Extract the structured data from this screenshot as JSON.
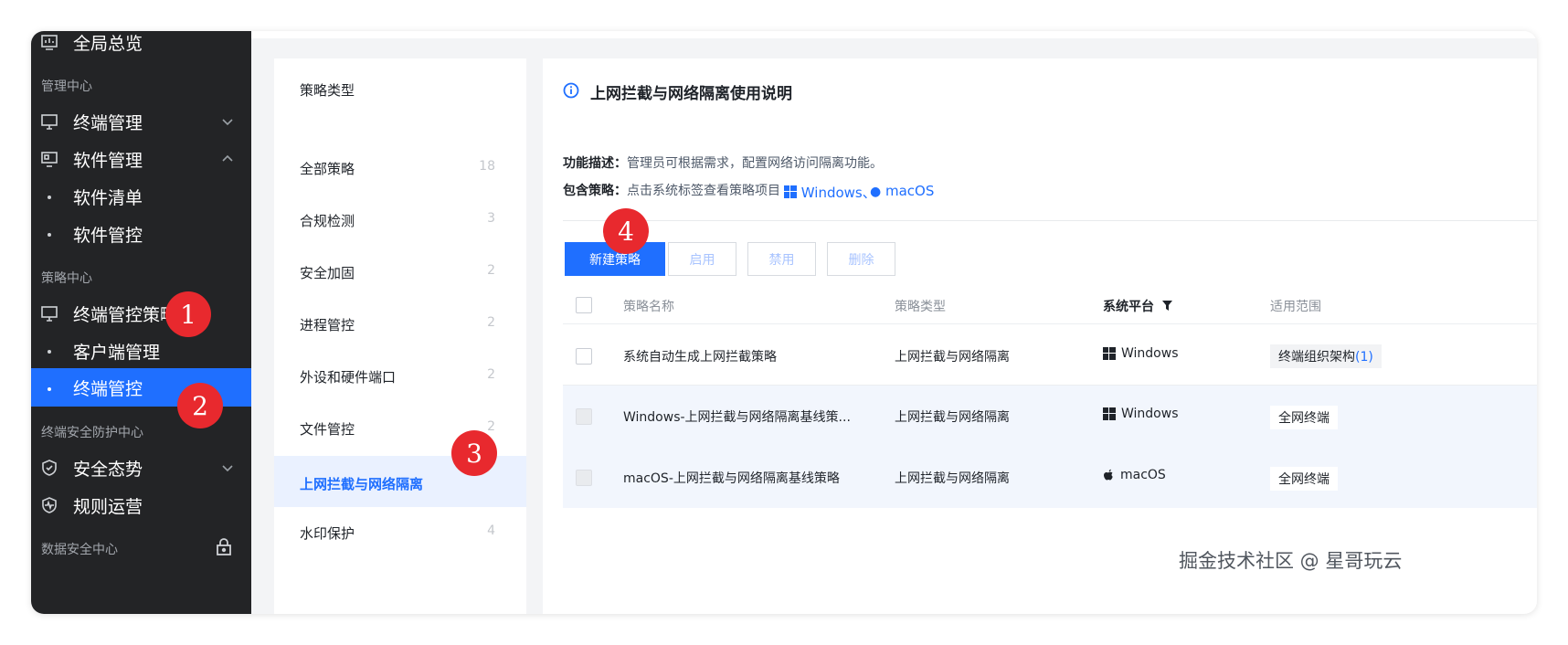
{
  "sidebar": {
    "overview": "全局总览",
    "section_manage": "管理中心",
    "terminal_manage": "终端管理",
    "software_manage": "软件管理",
    "software_list": "软件清单",
    "software_control": "软件管控",
    "section_policy": "策略中心",
    "terminal_policy": "终端管控策略",
    "client_manage": "客户端管理",
    "terminal_control": "终端管控",
    "section_security": "终端安全防护中心",
    "security_posture": "安全态势",
    "rule_ops": "规则运营",
    "section_data": "数据安全中心"
  },
  "categories": {
    "title": "策略类型",
    "items": [
      {
        "name": "全部策略",
        "count": "18"
      },
      {
        "name": "合规检测",
        "count": "3"
      },
      {
        "name": "安全加固",
        "count": "2"
      },
      {
        "name": "进程管控",
        "count": "2"
      },
      {
        "name": "外设和硬件端口",
        "count": "2"
      },
      {
        "name": "文件管控",
        "count": "2"
      },
      {
        "name": "上网拦截与网络隔离",
        "count": ""
      },
      {
        "name": "水印保护",
        "count": "4"
      }
    ]
  },
  "main": {
    "title": "上网拦截与网络隔离使用说明",
    "desc_label": "功能描述：",
    "desc_text": "管理员可根据需求，配置网络访问隔离功能。",
    "include_label": "包含策略：",
    "include_text": "点击系统标签查看策略项目",
    "platform_windows": "Windows、",
    "platform_macos": "macOS",
    "buttons": {
      "new": "新建策略",
      "enable": "启用",
      "disable": "禁用",
      "delete": "删除"
    },
    "columns": {
      "name": "策略名称",
      "type": "策略类型",
      "platform": "系统平台",
      "scope": "适用范围"
    },
    "rows": [
      {
        "name": "系统自动生成上网拦截策略",
        "type": "上网拦截与网络隔离",
        "platform": "Windows",
        "scope": "终端组织架构",
        "scope_count": "(1)"
      },
      {
        "name": "Windows-上网拦截与网络隔离基线策...",
        "type": "上网拦截与网络隔离",
        "platform": "Windows",
        "scope": "全网终端",
        "scope_count": ""
      },
      {
        "name": "macOS-上网拦截与网络隔离基线策略",
        "type": "上网拦截与网络隔离",
        "platform": "macOS",
        "scope": "全网终端",
        "scope_count": ""
      }
    ]
  },
  "badges": [
    "1",
    "2",
    "3",
    "4"
  ],
  "watermark": "掘金技术社区 @ 星哥玩云",
  "colors": {
    "accent": "#1f6fff",
    "sidebar_bg": "#232426",
    "badge": "#e8292e"
  },
  "icons": [
    "monitor-icon",
    "chevron-down-icon",
    "chevron-up-icon",
    "shield-icon",
    "lock-icon",
    "info-icon",
    "windows-icon",
    "apple-icon",
    "filter-icon"
  ]
}
